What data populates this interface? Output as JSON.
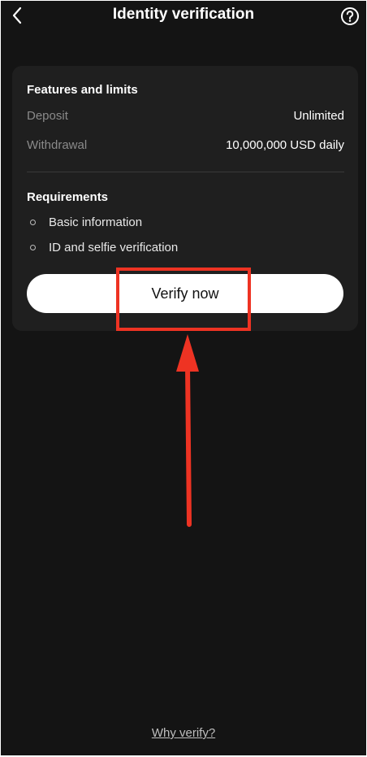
{
  "header": {
    "title": "Identity verification",
    "back_icon": "chevron-left-icon",
    "help_icon": "question-circle-icon"
  },
  "features": {
    "title": "Features and limits",
    "rows": [
      {
        "label": "Deposit",
        "value": "Unlimited"
      },
      {
        "label": "Withdrawal",
        "value": "10,000,000 USD daily"
      }
    ]
  },
  "requirements": {
    "title": "Requirements",
    "items": [
      "Basic information",
      "ID and selfie verification"
    ]
  },
  "verify_button": {
    "label": "Verify now"
  },
  "footer": {
    "why_link": "Why verify?"
  },
  "colors": {
    "background": "#141414",
    "card": "#1f1f1f",
    "annotation": "#ee3323",
    "button_bg": "#ffffff"
  }
}
